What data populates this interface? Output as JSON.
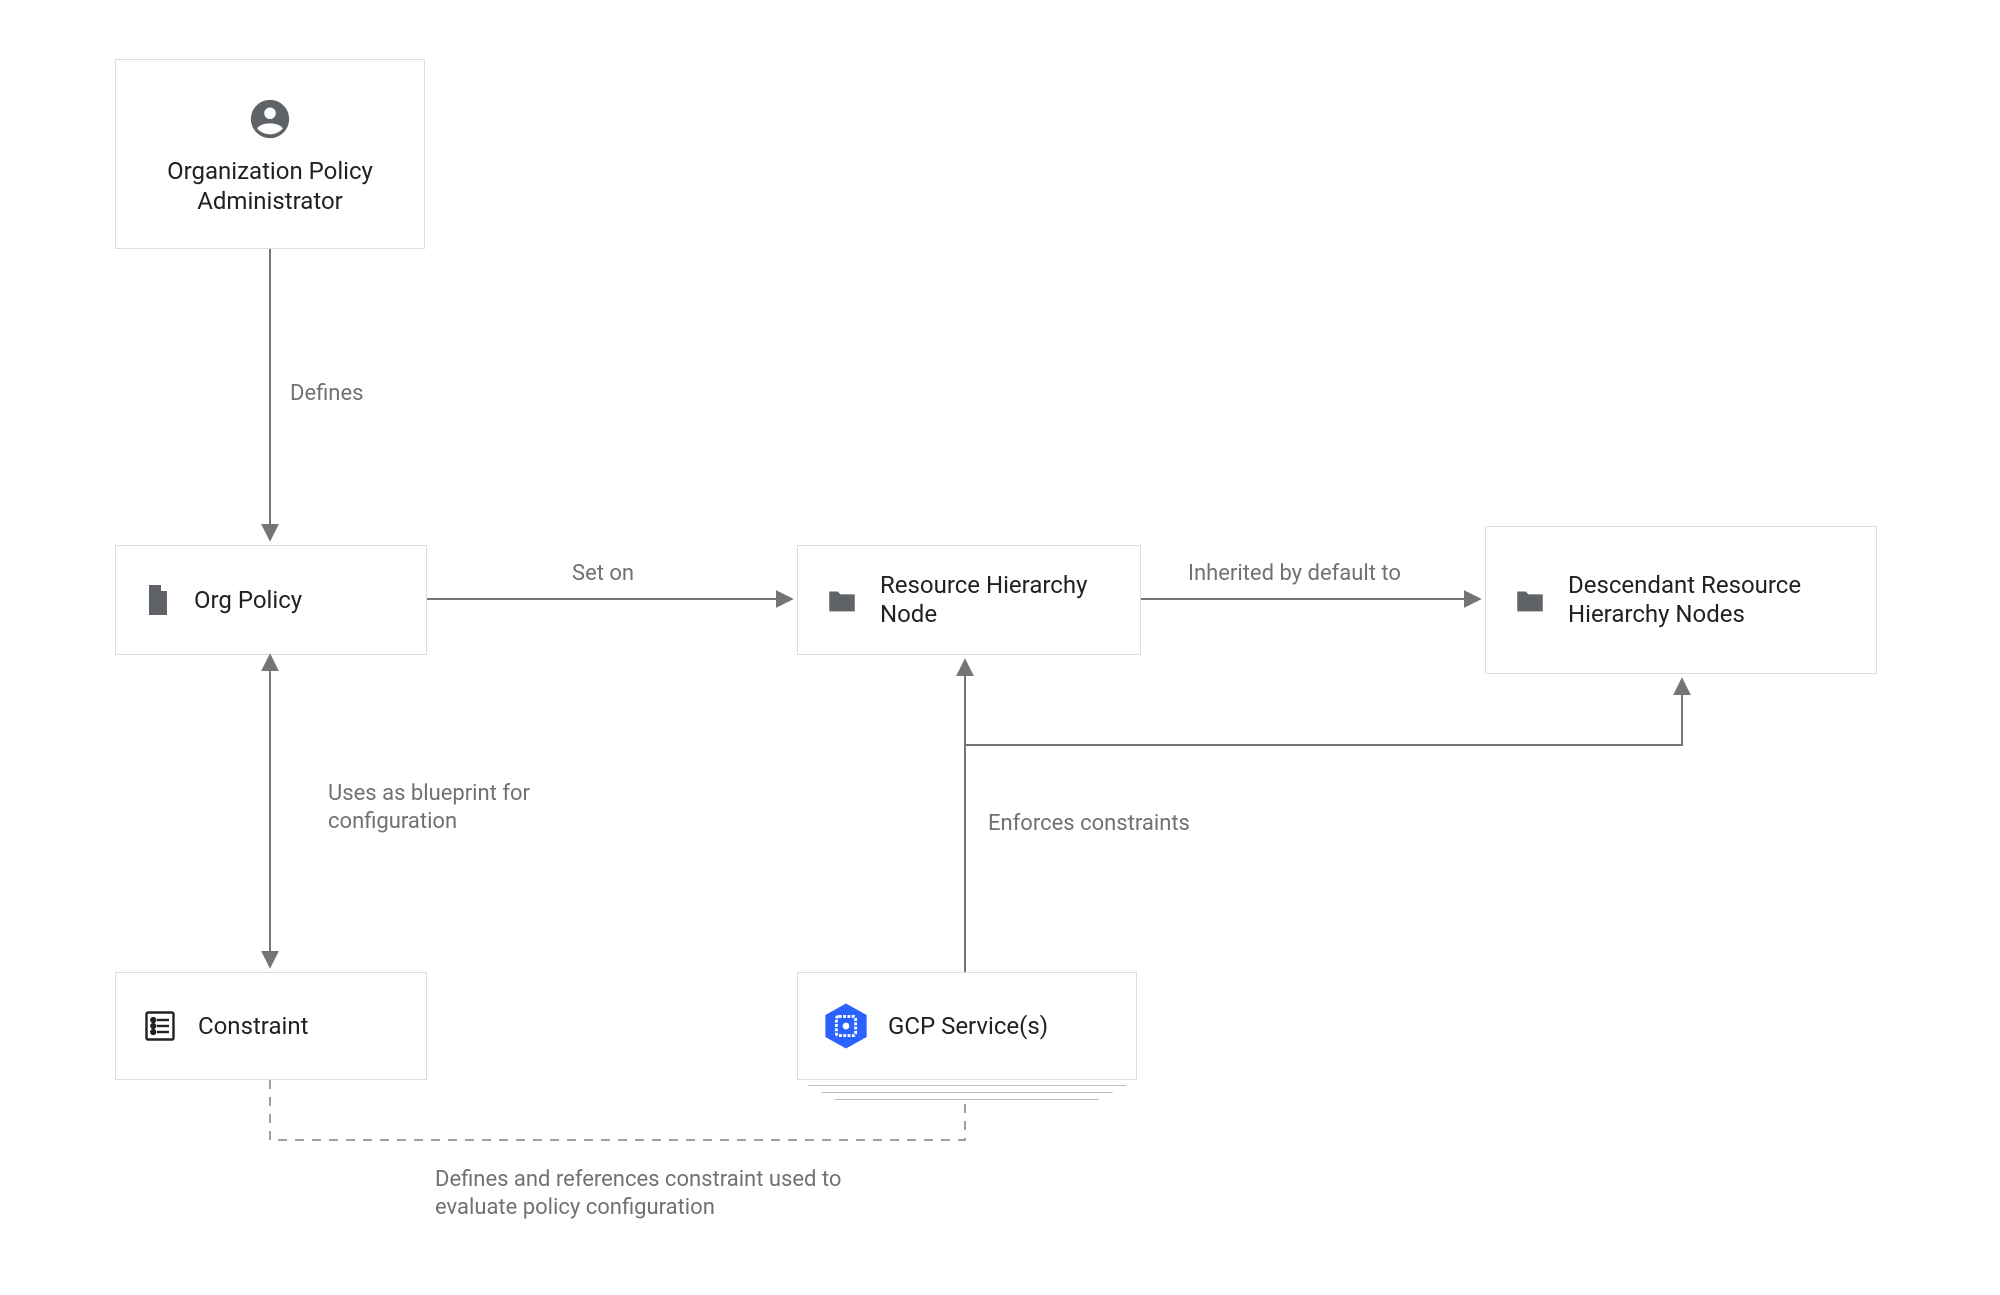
{
  "nodes": {
    "admin": {
      "title": "Organization Policy Administrator"
    },
    "org_policy": {
      "title": "Org Policy"
    },
    "resource_hierarchy_node": {
      "title": "Resource Hierarchy Node"
    },
    "descendant_nodes": {
      "title": "Descendant Resource Hierarchy Nodes"
    },
    "constraint": {
      "title": "Constraint"
    },
    "gcp_services": {
      "title": "GCP Service(s)"
    }
  },
  "edges": {
    "defines": "Defines",
    "set_on": "Set on",
    "inherited": "Inherited by default to",
    "blueprint": "Uses as blueprint for configuration",
    "enforces": "Enforces constraints",
    "defines_constraint": "Defines and references constraint used to evaluate policy configuration"
  },
  "colors": {
    "line": "#757575",
    "dash": "#9aa0a6",
    "text_muted": "#6f7275",
    "icon_dark": "#5f6368",
    "gcp_blue": "#2962ff"
  }
}
